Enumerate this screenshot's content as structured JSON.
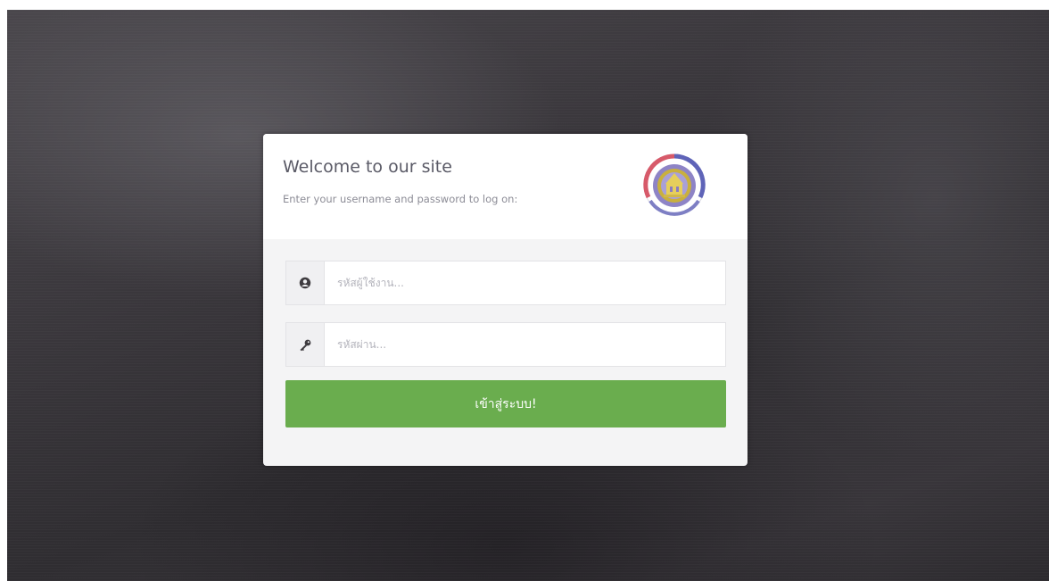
{
  "login": {
    "title": "Welcome to our site",
    "subtitle": "Enter your username and password to log on:",
    "username_placeholder": "รหัสผู้ใช้งาน...",
    "password_placeholder": "รหัสผ่าน...",
    "submit_label": "เข้าสู่ระบบ!"
  },
  "icons": {
    "username": "user-circle-icon",
    "password": "key-icon",
    "logo": "organization-emblem"
  },
  "colors": {
    "accent": "#6aad4e",
    "card_background": "#f4f4f5",
    "title_text": "#5a5a66"
  }
}
